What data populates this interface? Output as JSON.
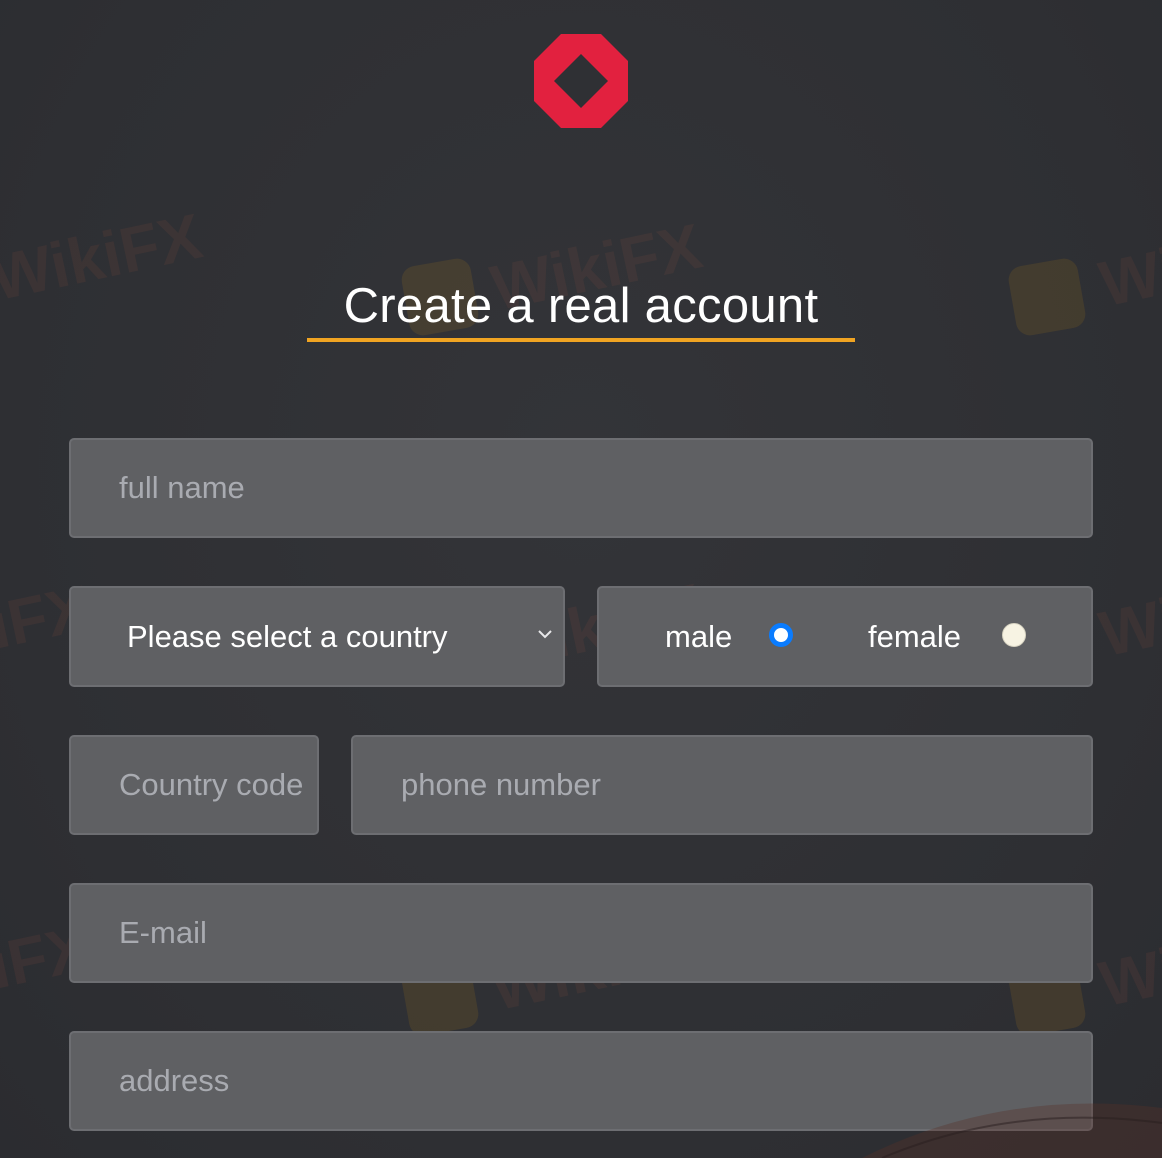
{
  "header": {
    "title": "Create a real account"
  },
  "form": {
    "full_name": {
      "placeholder": "full name",
      "value": ""
    },
    "country_select": {
      "selected": "Please select a country"
    },
    "gender": {
      "options": [
        "male",
        "female"
      ],
      "selected": "male"
    },
    "country_code": {
      "placeholder": "Country code",
      "value": ""
    },
    "phone": {
      "placeholder": "phone number",
      "value": ""
    },
    "email": {
      "placeholder": "E-mail",
      "value": ""
    },
    "address": {
      "placeholder": "address",
      "value": ""
    }
  },
  "colors": {
    "background": "#2f3034",
    "accent_underline": "#f0a422",
    "logo_red": "#e2213f",
    "field_bg": "#5f6063",
    "radio_checked": "#0a7cff"
  },
  "icons": {
    "logo": "red-octagon-ring-logo",
    "select_arrow": "chevron-down-icon"
  }
}
